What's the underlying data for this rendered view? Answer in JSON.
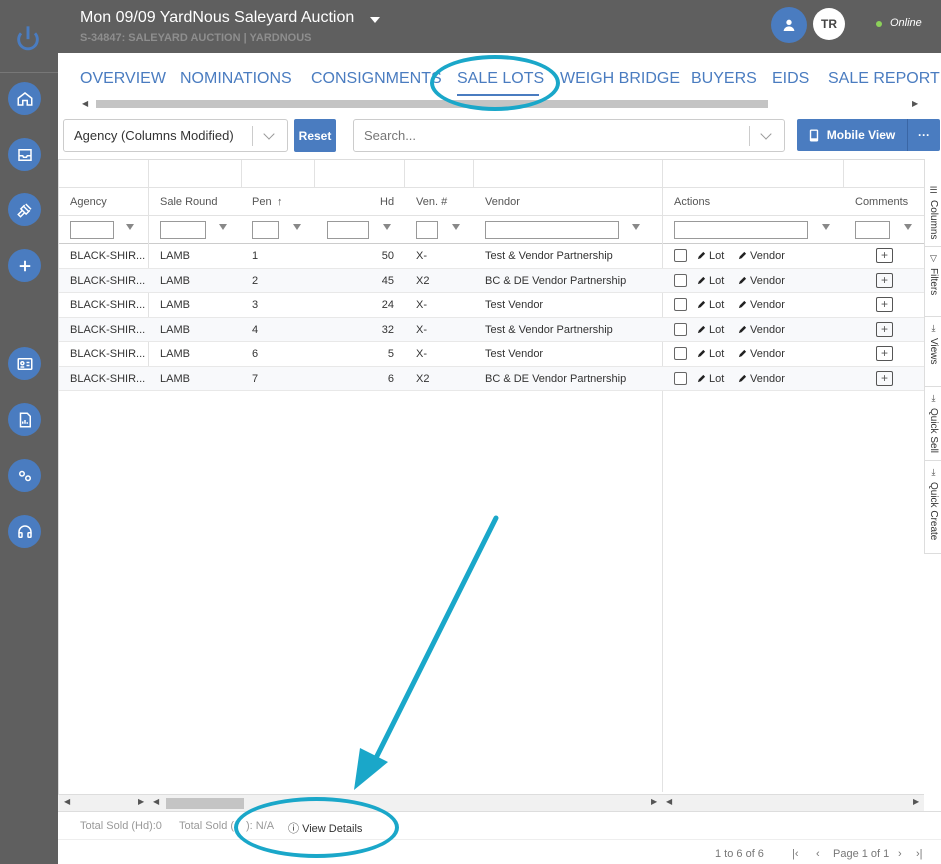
{
  "header": {
    "title": "Mon 09/09 YardNous Saleyard Auction",
    "subtitle": "S-34847: SALEYARD AUCTION | YARDNOUS",
    "user_initials": "TR",
    "status": "Online",
    "status_color": "#8cd15a"
  },
  "colors": {
    "accent": "#4a7cc0",
    "sidebar": "#5f5f5f",
    "highlight": "#1aa7c9"
  },
  "tabs": [
    {
      "label": "OVERVIEW"
    },
    {
      "label": "NOMINATIONS"
    },
    {
      "label": "CONSIGNMENTS"
    },
    {
      "label": "SALE LOTS",
      "active": true
    },
    {
      "label": "WEIGH BRIDGE"
    },
    {
      "label": "BUYERS"
    },
    {
      "label": "EIDS"
    },
    {
      "label": "SALE REPORT"
    }
  ],
  "toolbar": {
    "view_select": "Agency (Columns Modified)",
    "reset_label": "Reset",
    "search_placeholder": "Search...",
    "mobile_view_label": "Mobile View",
    "more_label": "···"
  },
  "grid": {
    "columns": [
      "Agency",
      "Sale Round",
      "Pen",
      "Hd",
      "Ven. #",
      "Vendor",
      "Actions",
      "Comments"
    ],
    "sort_indicator": "↑",
    "rows": [
      {
        "agency": "BLACK-SHIR...",
        "sale_round": "LAMB",
        "pen": "1",
        "hd": "50",
        "ven": "X-",
        "vendor": "Test & Vendor Partnership"
      },
      {
        "agency": "BLACK-SHIR...",
        "sale_round": "LAMB",
        "pen": "2",
        "hd": "45",
        "ven": "X2",
        "vendor": "BC & DE Vendor Partnership"
      },
      {
        "agency": "BLACK-SHIR...",
        "sale_round": "LAMB",
        "pen": "3",
        "hd": "24",
        "ven": "X-",
        "vendor": "Test Vendor"
      },
      {
        "agency": "BLACK-SHIR...",
        "sale_round": "LAMB",
        "pen": "4",
        "hd": "32",
        "ven": "X-",
        "vendor": "Test & Vendor Partnership"
      },
      {
        "agency": "BLACK-SHIR...",
        "sale_round": "LAMB",
        "pen": "6",
        "hd": "5",
        "ven": "X-",
        "vendor": "Test Vendor"
      },
      {
        "agency": "BLACK-SHIR...",
        "sale_round": "LAMB",
        "pen": "7",
        "hd": "6",
        "ven": "X2",
        "vendor": "BC & DE Vendor Partnership"
      }
    ],
    "action_lot": "Lot",
    "action_vendor": "Vendor"
  },
  "side_panel": [
    "Columns",
    "Filters",
    "Views",
    "Quick Sell",
    "Quick Create"
  ],
  "footer": {
    "total_sold_hd": "Total Sold (Hd):0",
    "total_sold_other": "Total Sold (",
    "total_sold_value": "): N/A",
    "view_details": "View Details"
  },
  "pager": {
    "range": "1 to 6 of 6",
    "page": "Page 1 of 1"
  }
}
